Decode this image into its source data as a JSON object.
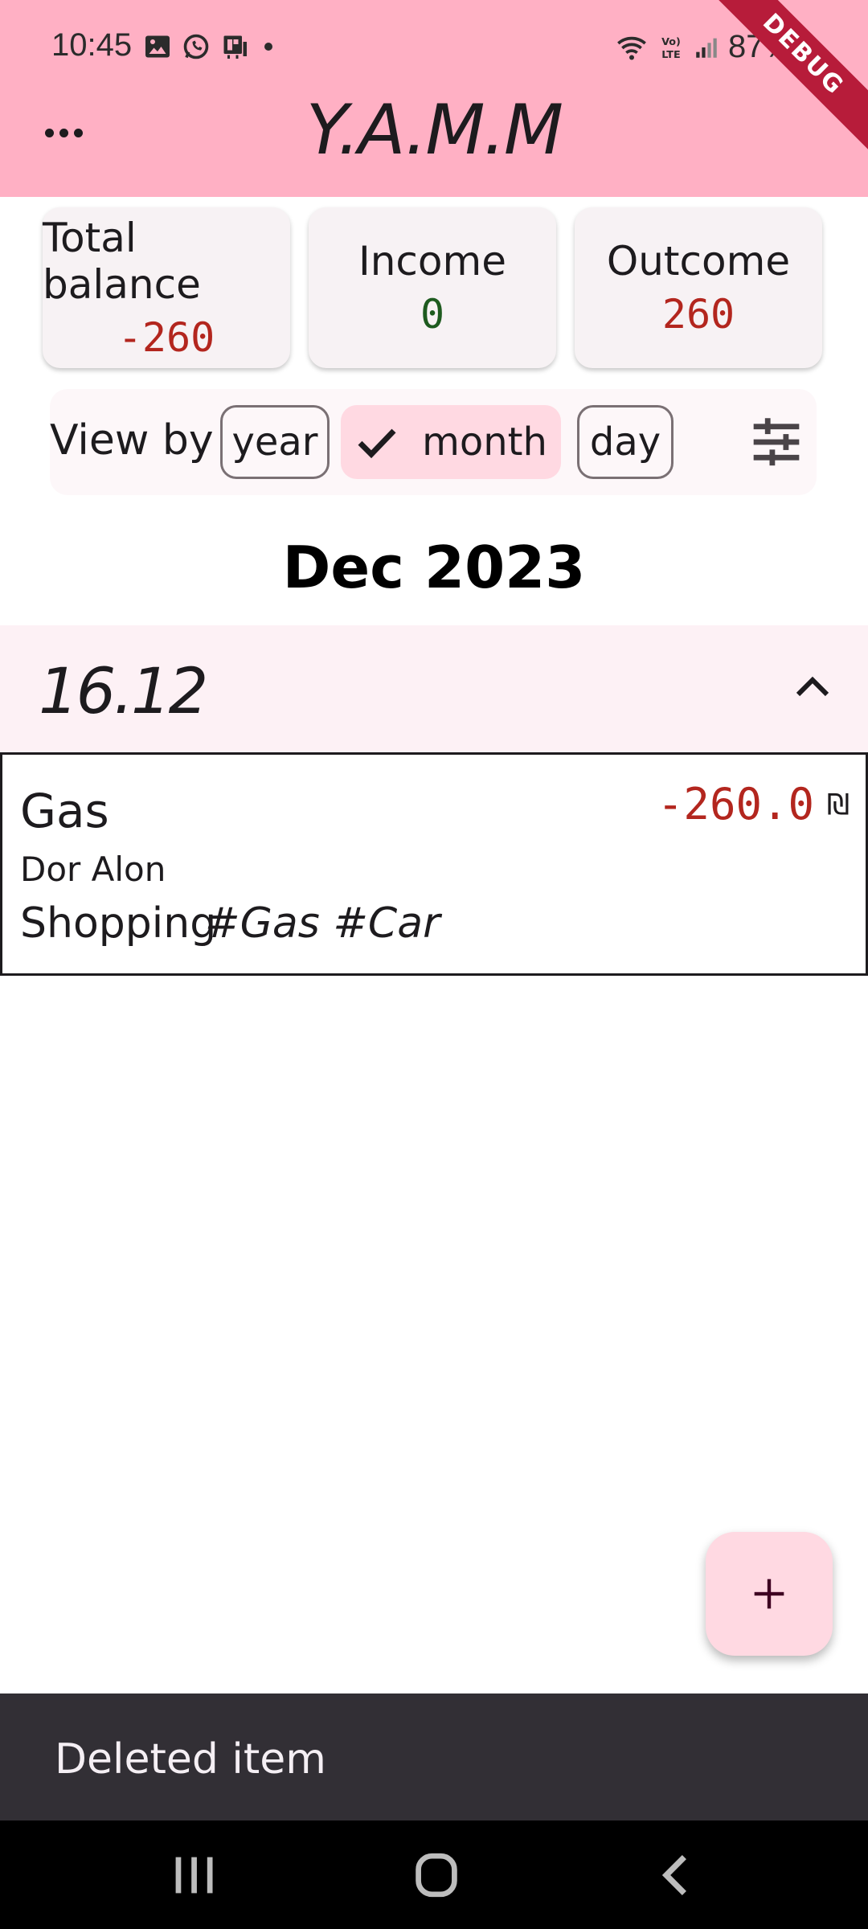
{
  "status_bar": {
    "time": "10:45",
    "battery": "87%",
    "left_icons": [
      "image-icon",
      "whatsapp-icon",
      "cast-icon",
      "dot-icon"
    ],
    "right_icons": [
      "wifi-icon",
      "volte-icon",
      "signal-icon",
      "battery-icon"
    ]
  },
  "debug_banner": "DEBUG",
  "app_bar": {
    "title": "Y.A.M.M",
    "menu_icon": "more-horiz-icon",
    "background": "#ffb0c4"
  },
  "summary": {
    "total_balance": {
      "label": "Total balance",
      "value": "-260"
    },
    "income": {
      "label": "Income",
      "value": "0"
    },
    "outcome": {
      "label": "Outcome",
      "value": "260"
    }
  },
  "view_by": {
    "label": "View by",
    "options": [
      "year",
      "month",
      "day"
    ],
    "selected": "month",
    "filter_icon": "tune-icon"
  },
  "period_title": "Dec 2023",
  "groups": [
    {
      "date": "16.12",
      "expanded": true,
      "transactions": [
        {
          "name": "Gas",
          "payee": "Dor Alon",
          "category": "Shopping",
          "tags": "#Gas #Car",
          "amount": "-260.0",
          "currency": "₪"
        }
      ]
    }
  ],
  "fab": {
    "icon": "add-icon",
    "label": "+"
  },
  "snackbar": {
    "text": "Deleted item"
  },
  "nav_bar": [
    "recents-icon",
    "home-icon",
    "back-icon"
  ],
  "colors": {
    "negative": "#b3261e",
    "positive": "#1e5b1f",
    "accent_container": "#ffd9e2"
  }
}
